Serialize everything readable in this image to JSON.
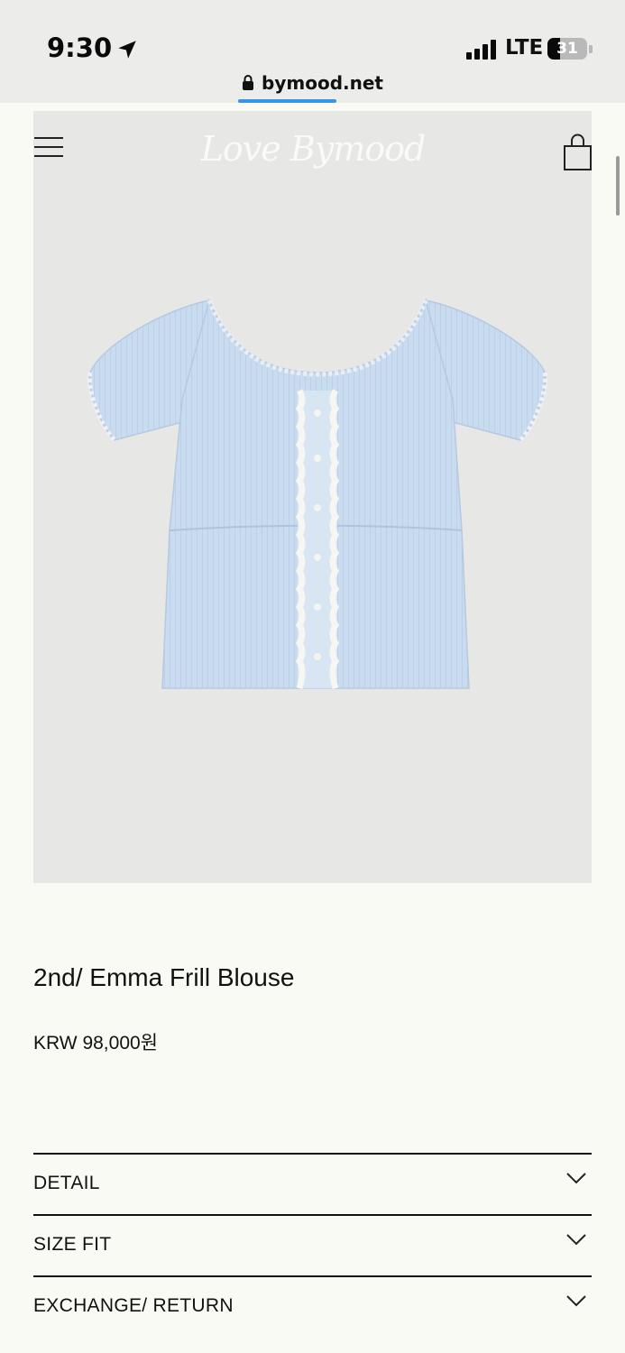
{
  "status": {
    "time": "9:30",
    "network": "LTE",
    "battery": "31",
    "battery_level": 0.31
  },
  "browser": {
    "url": "bymood.net"
  },
  "header": {
    "logo_text": "Love Bymood"
  },
  "product": {
    "title": "2nd/ Emma Frill Blouse",
    "price": "KRW 98,000원",
    "image_color": "#c9dbef"
  },
  "accordion": [
    {
      "label": "DETAIL"
    },
    {
      "label": "SIZE FIT"
    },
    {
      "label": "EXCHANGE/ RETURN"
    }
  ],
  "icons": {
    "menu": "hamburger-menu-icon",
    "cart": "shopping-bag-icon",
    "chevron": "chevron-down-icon",
    "location": "location-arrow-icon",
    "lock": "lock-icon"
  }
}
